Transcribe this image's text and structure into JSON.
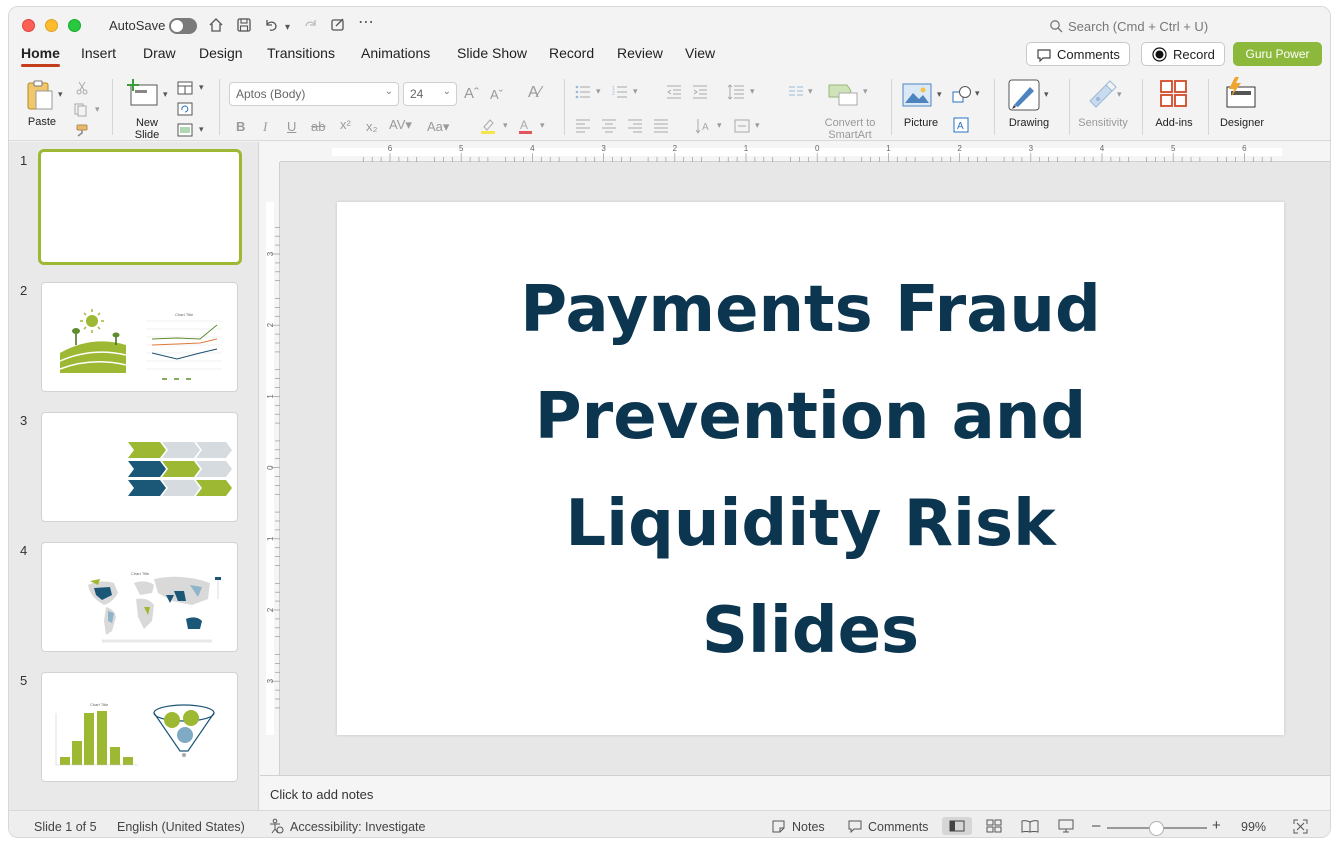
{
  "titlebar": {
    "autosave_label": "AutoSave",
    "search_placeholder": "Search (Cmd + Ctrl + U)"
  },
  "tabs": [
    {
      "label": "Home",
      "active": true
    },
    {
      "label": "Insert"
    },
    {
      "label": "Draw"
    },
    {
      "label": "Design"
    },
    {
      "label": "Transitions"
    },
    {
      "label": "Animations"
    },
    {
      "label": "Slide Show"
    },
    {
      "label": "Record"
    },
    {
      "label": "Review"
    },
    {
      "label": "View"
    }
  ],
  "actions": {
    "comments_label": "Comments",
    "record_label": "Record",
    "guru_label": "Guru Power",
    "guru_color": "#8cb83b"
  },
  "ribbon": {
    "paste_label": "Paste",
    "new_slide_label": "New\nSlide",
    "font_name": "Aptos (Body)",
    "font_size": "24",
    "convert_smartart_label": "Convert to\nSmartArt",
    "picture_label": "Picture",
    "drawing_label": "Drawing",
    "sensitivity_label": "Sensitivity",
    "addins_label": "Add-ins",
    "designer_label": "Designer"
  },
  "slides": [
    {
      "number": "1",
      "selected": true
    },
    {
      "number": "2"
    },
    {
      "number": "3"
    },
    {
      "number": "4"
    },
    {
      "number": "5"
    }
  ],
  "thumb_texts": {
    "chart_title": "Chart Title"
  },
  "slide": {
    "title_lines": [
      "Payments Fraud",
      "Prevention and",
      "Liquidity Risk",
      "Slides"
    ],
    "title_color": "#0c3550"
  },
  "ruler": {
    "h_labels": [
      "6",
      "5",
      "4",
      "3",
      "2",
      "1",
      "0",
      "1",
      "2",
      "3",
      "4",
      "5",
      "6"
    ],
    "v_labels": [
      "3",
      "2",
      "1",
      "0",
      "1",
      "2",
      "3"
    ]
  },
  "notes_placeholder": "Click to add notes",
  "status": {
    "slide_info": "Slide 1 of 5",
    "language": "English (United States)",
    "accessibility": "Accessibility: Investigate",
    "notes_label": "Notes",
    "comments_label": "Comments",
    "zoom_percent": "99%"
  },
  "colors": {
    "accent_red": "#c43e1c",
    "theme_green": "#9db833",
    "theme_navy": "#1b4f72"
  }
}
